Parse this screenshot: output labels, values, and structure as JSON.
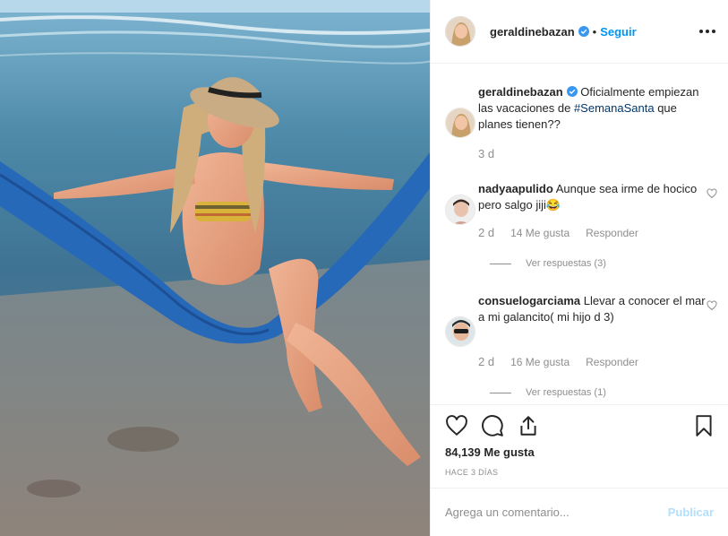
{
  "post": {
    "username": "geraldinebazan",
    "separator": "•",
    "follow_label": "Seguir",
    "more_icon": "more-horizontal-icon",
    "verified_icon": "verified-badge-icon",
    "photo_alt": "Mujer con sombrero y bikini sentada en una hamaca azul a la orilla del mar"
  },
  "caption": {
    "username": "geraldinebazan",
    "text_before": " Oficialmente empiezan las vacaciones de ",
    "hashtag": "#SemanaSanta",
    "text_after": " que planes tienen??",
    "time": "3 d"
  },
  "comments": [
    {
      "username": "nadyaapulido",
      "text": " Aunque sea irme de hocico pero salgo jiji😂",
      "time": "2 d",
      "likes": "14 Me gusta",
      "reply_label": "Responder",
      "view_replies": "Ver respuestas (3)"
    },
    {
      "username": "consuelogarciama",
      "text": " Llevar a conocer el mar a mi galancito( mi hijo d 3)",
      "time": "2 d",
      "likes": "16 Me gusta",
      "reply_label": "Responder",
      "view_replies": "Ver respuestas (1)"
    }
  ],
  "actions": {
    "likes_text": "84,139 Me gusta",
    "posted_ago": "HACE 3 DÍAS"
  },
  "composer": {
    "placeholder": "Agrega un comentario...",
    "publish_label": "Publicar"
  },
  "colors": {
    "link_blue": "#0095f6",
    "hashtag": "#00376b",
    "muted": "#8e8e8e",
    "publish_disabled": "#b2dffc"
  }
}
